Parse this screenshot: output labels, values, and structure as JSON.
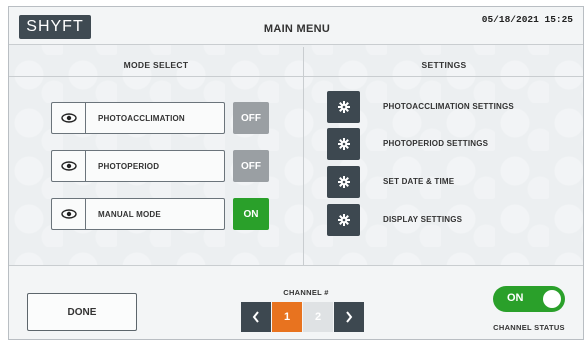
{
  "header": {
    "logo_text": "SHYFT",
    "title": "MAIN MENU",
    "datetime": "05/18/2021 15:25"
  },
  "mode_select": {
    "heading": "MODE SELECT",
    "items": [
      {
        "label": "PHOTOACCLIMATION",
        "state": "OFF",
        "state_color": "#9a9fa3",
        "icon": "eye-icon"
      },
      {
        "label": "PHOTOPERIOD",
        "state": "OFF",
        "state_color": "#9a9fa3",
        "icon": "eye-icon"
      },
      {
        "label": "MANUAL MODE",
        "state": "ON",
        "state_color": "#2aa02a",
        "icon": "eye-icon"
      }
    ]
  },
  "settings": {
    "heading": "SETTINGS",
    "items": [
      {
        "label": "PHOTOACCLIMATION SETTINGS",
        "icon": "gear-icon"
      },
      {
        "label": "PHOTOPERIOD SETTINGS",
        "icon": "gear-icon"
      },
      {
        "label": "SET DATE & TIME",
        "icon": "gear-icon"
      },
      {
        "label": "DISPLAY SETTINGS",
        "icon": "gear-icon"
      }
    ]
  },
  "footer": {
    "done_label": "DONE",
    "channel_heading": "CHANNEL #",
    "channels": [
      "1",
      "2"
    ],
    "selected_channel": "1",
    "channel_state": "ON",
    "channel_status_label": "CHANNEL STATUS"
  },
  "colors": {
    "accent_orange": "#e8731f",
    "on_green": "#2aa02a",
    "off_gray": "#9a9fa3",
    "dark_button": "#3d4850"
  }
}
